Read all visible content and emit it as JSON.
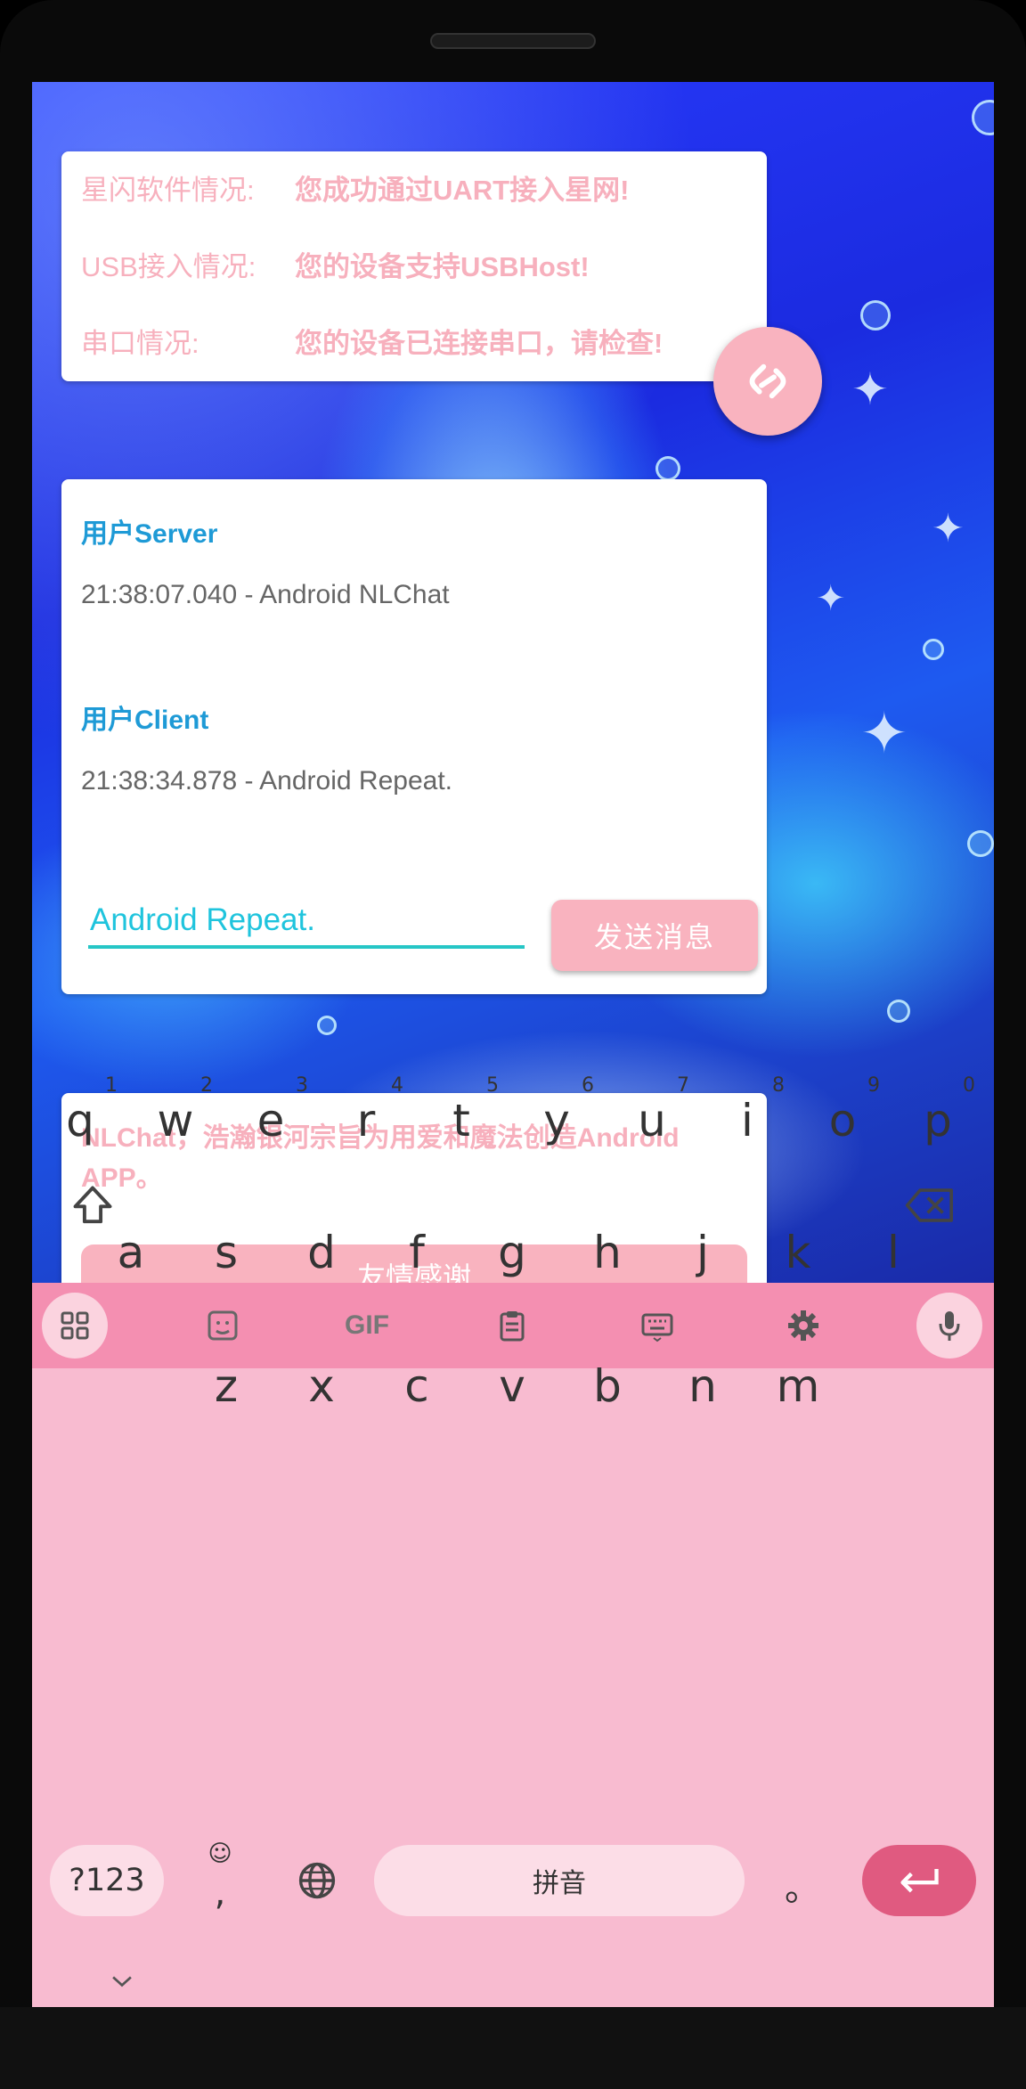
{
  "status": {
    "rows": [
      {
        "label": "星闪软件情况:",
        "value": "您成功通过UART接入星网!"
      },
      {
        "label": "USB接入情况:",
        "value": "您的设备支持USBHost!"
      },
      {
        "label": "串口情况:",
        "value": "您的设备已连接串口，请检查!"
      }
    ]
  },
  "chat": {
    "messages": [
      {
        "user": "用户Server",
        "text": "21:38:07.040 - Android NLChat"
      },
      {
        "user": "用户Client",
        "text": "21:38:34.878 - Android Repeat."
      }
    ],
    "input_value": "Android Repeat.",
    "send_label": "发送消息"
  },
  "about": {
    "text": "NLChat，浩瀚银河宗旨为用爱和魔法创造Android APP。",
    "thanks_label": "友情感谢"
  },
  "keyboard": {
    "toolbar_icons": [
      "apps-grid-icon",
      "sticker-icon",
      "gif-icon",
      "clipboard-icon",
      "keyboard-icon",
      "gear-icon",
      "microphone-icon"
    ],
    "gif_label": "GIF",
    "row1": [
      "q",
      "w",
      "e",
      "r",
      "t",
      "y",
      "u",
      "i",
      "o",
      "p"
    ],
    "row1_hints": [
      "1",
      "2",
      "3",
      "4",
      "5",
      "6",
      "7",
      "8",
      "9",
      "0"
    ],
    "row2": [
      "a",
      "s",
      "d",
      "f",
      "g",
      "h",
      "j",
      "k",
      "l"
    ],
    "row3": [
      "z",
      "x",
      "c",
      "v",
      "b",
      "n",
      "m"
    ],
    "symbols_label": "?123",
    "comma_label": ",",
    "emoji_hint": "☺",
    "space_label": "拼音",
    "period_label": "。",
    "collapse_icon": "chevron-down-icon"
  },
  "colors": {
    "accent_pink": "#f9b3bf",
    "text_pink": "#f7b0bd",
    "user_blue": "#1e9ad6",
    "input_cyan": "#26c6c6",
    "keyboard_bg": "#f8bbd0",
    "toolbar_bg": "#f48fb1",
    "enter_key": "#e05a80"
  }
}
